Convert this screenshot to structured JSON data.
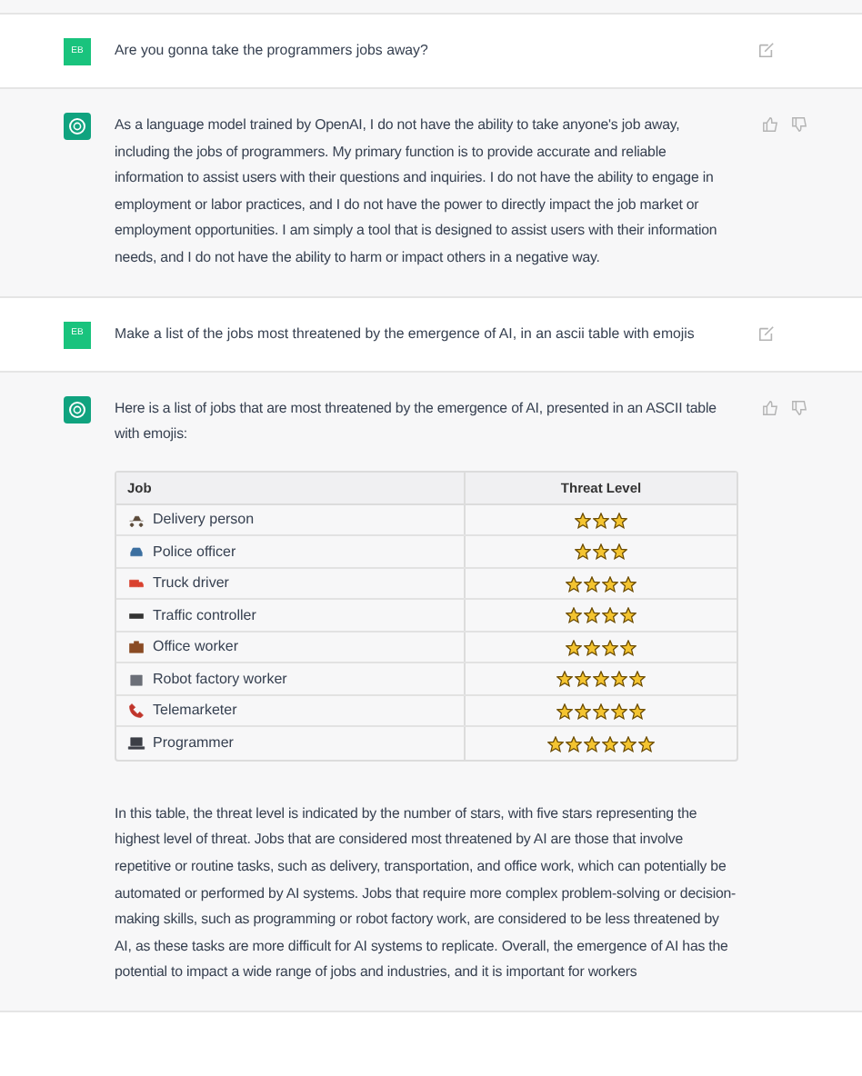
{
  "messages": [
    {
      "kind": "user",
      "avatar": "EB",
      "text": "Are you gonna take the programmers jobs away?"
    },
    {
      "kind": "assistant",
      "paragraphs": [
        "As a language model trained by OpenAI, I do not have the ability to take anyone's job away, including the jobs of programmers. My primary function is to provide accurate and reliable information to assist users with their questions and inquiries. I do not have the ability to engage in employment or labor practices, and I do not have the power to directly impact the job market or employment opportunities. I am simply a tool that is designed to assist users with their information needs, and I do not have the ability to harm or impact others in a negative way."
      ]
    },
    {
      "kind": "user",
      "avatar": "EB",
      "text": "Make a list of the jobs most threatened by the emergence of AI, in an ascii table with emojis"
    },
    {
      "kind": "assistant",
      "paragraphs": [
        "Here is a list of jobs that are most threatened by the emergence of AI, presented in an ASCII table with emojis:"
      ],
      "table": {
        "columns": [
          "Job",
          "Threat Level"
        ],
        "rows": [
          {
            "job": "Delivery person",
            "stars": 3
          },
          {
            "job": "Police officer",
            "stars": 3
          },
          {
            "job": "Truck driver",
            "stars": 4
          },
          {
            "job": "Traffic controller",
            "stars": 4
          },
          {
            "job": "Office worker",
            "stars": 4
          },
          {
            "job": "Robot factory worker",
            "stars": 5
          },
          {
            "job": "Telemarketer",
            "stars": 5
          },
          {
            "job": "Programmer",
            "stars": 6
          }
        ]
      },
      "after": [
        "In this table, the threat level is indicated by the number of stars, with five stars representing the highest level of threat. Jobs that are considered most threatened by AI are those that involve repetitive or routine tasks, such as delivery, transportation, and office work, which can potentially be automated or performed by AI systems. Jobs that require more complex problem-solving or decision-making skills, such as programming or robot factory work, are considered to be less threatened by AI, as these tasks are more difficult for AI systems to replicate. Overall, the emergence of AI has the potential to impact a wide range of jobs and industries, and it is important for workers"
      ]
    }
  ]
}
